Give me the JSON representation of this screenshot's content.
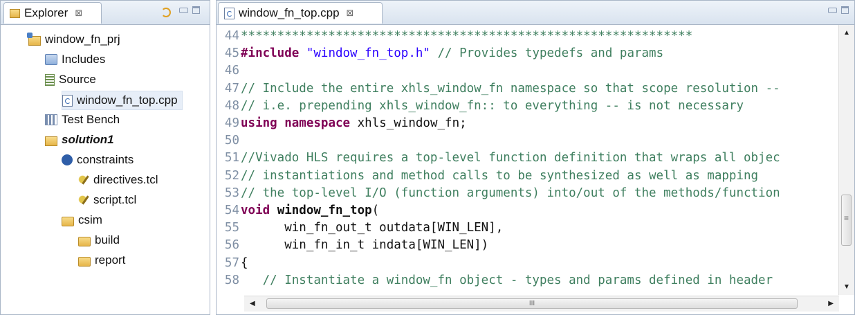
{
  "explorer": {
    "tab_label": "Explorer",
    "tab_close": "⊠",
    "tree": [
      {
        "label": "window_fn_prj",
        "icon": "project-folder-icon",
        "bold": false
      },
      {
        "label": "Includes",
        "icon": "includes-icon",
        "bold": false
      },
      {
        "label": "Source",
        "icon": "source-icon",
        "bold": false
      },
      {
        "label": "window_fn_top.cpp",
        "icon": "cpp-file-icon",
        "bold": false,
        "selected": true
      },
      {
        "label": "Test Bench",
        "icon": "test-bench-icon",
        "bold": false
      },
      {
        "label": "solution1",
        "icon": "solution-folder-icon",
        "bold": true
      },
      {
        "label": "constraints",
        "icon": "gear-icon",
        "bold": false
      },
      {
        "label": "directives.tcl",
        "icon": "tcl-file-icon",
        "bold": false
      },
      {
        "label": "script.tcl",
        "icon": "tcl-file-icon",
        "bold": false
      },
      {
        "label": "csim",
        "icon": "folder-icon",
        "bold": false
      },
      {
        "label": "build",
        "icon": "folder-icon",
        "bold": false
      },
      {
        "label": "report",
        "icon": "folder-icon",
        "bold": false
      }
    ]
  },
  "editor": {
    "tab_label": "window_fn_top.cpp",
    "tab_close": "⊠",
    "lines": [
      {
        "n": "44",
        "segs": [
          [
            "cm",
            "**************************************************************"
          ]
        ]
      },
      {
        "n": "45",
        "segs": [
          [
            "kw",
            "#include"
          ],
          [
            "pl",
            " "
          ],
          [
            "str",
            "\"window_fn_top.h\""
          ],
          [
            "cm",
            " // Provides typedefs and params"
          ]
        ]
      },
      {
        "n": "46",
        "segs": []
      },
      {
        "n": "47",
        "segs": [
          [
            "cm",
            "// Include the entire xhls_window_fn namespace so that scope resolution --"
          ]
        ]
      },
      {
        "n": "48",
        "segs": [
          [
            "cm",
            "// i.e. prepending xhls_window_fn:: to everything -- is not necessary"
          ]
        ]
      },
      {
        "n": "49",
        "segs": [
          [
            "kw",
            "using"
          ],
          [
            "pl",
            " "
          ],
          [
            "kw",
            "namespace"
          ],
          [
            "pl",
            " xhls_window_fn;"
          ]
        ]
      },
      {
        "n": "50",
        "segs": []
      },
      {
        "n": "51",
        "segs": [
          [
            "cm",
            "//Vivado HLS requires a top-level function definition that wraps all objec"
          ]
        ]
      },
      {
        "n": "52",
        "segs": [
          [
            "cm",
            "// instantiations and method calls to be synthesized as well as mapping"
          ]
        ]
      },
      {
        "n": "53",
        "segs": [
          [
            "cm",
            "// the top-level I/O (function arguments) into/out of the methods/function"
          ]
        ]
      },
      {
        "n": "54",
        "segs": [
          [
            "kw",
            "void"
          ],
          [
            "pl",
            " "
          ],
          [
            "fn",
            "window_fn_top"
          ],
          [
            "pl",
            "("
          ]
        ]
      },
      {
        "n": "55",
        "segs": [
          [
            "pl",
            "      win_fn_out_t outdata[WIN_LEN],"
          ]
        ]
      },
      {
        "n": "56",
        "segs": [
          [
            "pl",
            "      win_fn_in_t indata[WIN_LEN])"
          ]
        ]
      },
      {
        "n": "57",
        "segs": [
          [
            "pl",
            "{"
          ]
        ]
      },
      {
        "n": "58",
        "segs": [
          [
            "cm",
            "   // Instantiate a window_fn object - types and params defined in header"
          ]
        ]
      }
    ],
    "hscroll_grip": "III",
    "vscroll_grip": "≡"
  }
}
